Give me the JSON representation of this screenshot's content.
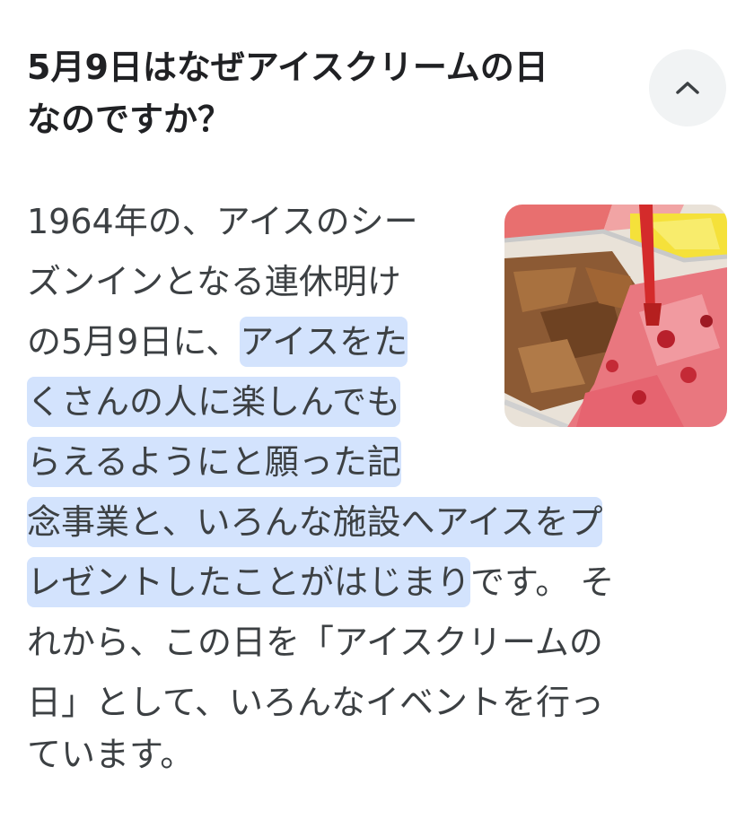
{
  "question": {
    "line1": "5月9日はなぜアイスクリームの日",
    "line2": "なのですか？"
  },
  "collapse_button": {
    "icon": "chevron-up-icon"
  },
  "thumbnail": {
    "alt": "ice cream display"
  },
  "answer": {
    "lines": [
      {
        "plain": "1964年の、アイスのシー",
        "hl": "",
        "after": ""
      },
      {
        "plain": "ズンインとなる連休明け",
        "hl": "",
        "after": ""
      },
      {
        "plain": "の5月9日に、",
        "hl": "アイスをた",
        "after": ""
      },
      {
        "plain": "",
        "hl": "くさんの人に楽しんでも",
        "after": ""
      },
      {
        "plain": "",
        "hl": "らえるようにと願った記",
        "after": ""
      },
      {
        "plain": "",
        "hl": "念事業と、いろんな施設へアイスをプ",
        "after": ""
      },
      {
        "plain": "",
        "hl": "レゼントしたことがはじまり",
        "after": "です。 そ"
      },
      {
        "plain": "れから、この日を「アイスクリームの",
        "hl": "",
        "after": ""
      },
      {
        "plain": "日」として、いろんなイベントを行っ",
        "hl": "",
        "after": ""
      },
      {
        "plain": "ています。",
        "hl": "",
        "after": ""
      }
    ]
  },
  "colors": {
    "highlight": "#d3e3fd",
    "text": "#3c4043",
    "heading": "#202124",
    "button_bg": "#f1f3f4"
  }
}
